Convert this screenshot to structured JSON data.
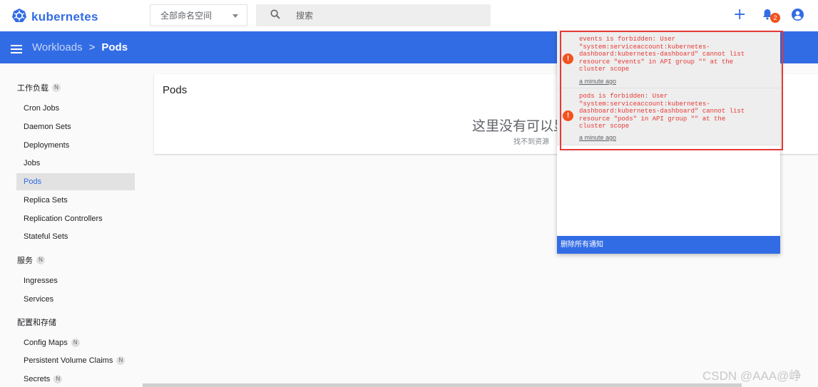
{
  "header": {
    "logo_text": "kubernetes",
    "namespace": "全部命名空间",
    "search_placeholder": "搜索",
    "notification_count": "2"
  },
  "breadcrumb": {
    "parent": "Workloads",
    "separator": ">",
    "current": "Pods"
  },
  "sidebar": {
    "workloads": {
      "title": "工作负载",
      "badge": "N",
      "items": [
        "Cron Jobs",
        "Daemon Sets",
        "Deployments",
        "Jobs",
        "Pods",
        "Replica Sets",
        "Replication Controllers",
        "Stateful Sets"
      ]
    },
    "service": {
      "title": "服务",
      "badge": "N",
      "items": [
        "Ingresses",
        "Services"
      ]
    },
    "config": {
      "title": "配置和存储",
      "items": [
        "Config Maps",
        "Persistent Volume Claims",
        "Secrets"
      ],
      "item_badge": "N"
    }
  },
  "main": {
    "card_title": "Pods",
    "empty_title": "这里没有可以显",
    "empty_subtitle": "找不到资源"
  },
  "notifications": {
    "items": [
      {
        "message": "events is forbidden: User\n\"system:serviceaccount:kubernetes-\ndashboard:kubernetes-dashboard\" cannot list\nresource \"events\" in API group \"\" at the\ncluster scope",
        "time": "a minute ago"
      },
      {
        "message": "pods is forbidden: User\n\"system:serviceaccount:kubernetes-\ndashboard:kubernetes-dashboard\" cannot list\nresource \"pods\" in API group \"\" at the\ncluster scope",
        "time": "a minute ago"
      }
    ],
    "clear_all": "删除所有通知"
  },
  "watermark": "CSDN @AAA@峥",
  "colors": {
    "primary": "#326ce5",
    "error": "#e53935",
    "badge": "#f4511e"
  }
}
